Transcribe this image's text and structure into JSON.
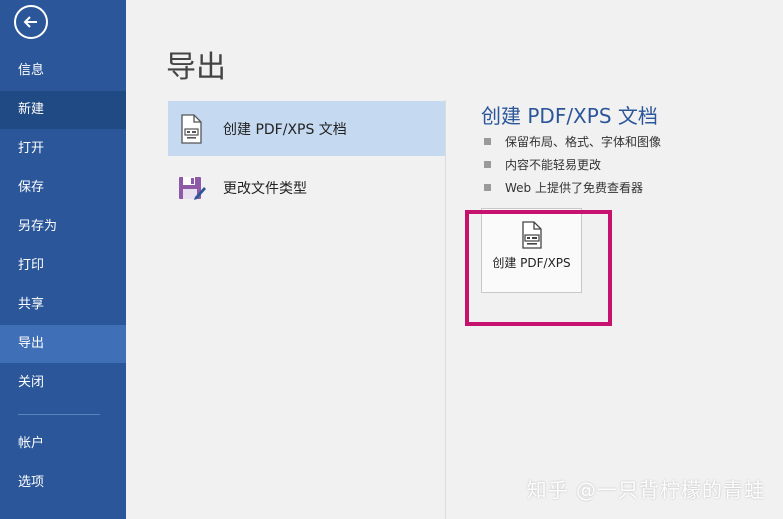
{
  "sidebar": {
    "items": [
      {
        "label": "信息"
      },
      {
        "label": "新建"
      },
      {
        "label": "打开"
      },
      {
        "label": "保存"
      },
      {
        "label": "另存为"
      },
      {
        "label": "打印"
      },
      {
        "label": "共享"
      },
      {
        "label": "导出"
      },
      {
        "label": "关闭"
      },
      {
        "label": "帐户"
      },
      {
        "label": "选项"
      }
    ],
    "selected": "导出"
  },
  "main": {
    "title": "导出",
    "options": [
      {
        "label": "创建 PDF/XPS 文档",
        "icon": "pdf-document-icon"
      },
      {
        "label": "更改文件类型",
        "icon": "save-as-type-icon"
      }
    ],
    "detail": {
      "title": "创建 PDF/XPS 文档",
      "bullets": [
        "保留布局、格式、字体和图像",
        "内容不能轻易更改",
        "Web 上提供了免费查看器"
      ],
      "action_label": "创建 PDF/XPS"
    }
  },
  "watermark": "知乎 @一只背柠檬的青蛙",
  "colors": {
    "sidebar": "#2b579a",
    "selected_nav": "#3f6fb6",
    "selected_option": "#c5d9f1",
    "accent_title": "#2b579a",
    "highlight": "#c4126e"
  }
}
